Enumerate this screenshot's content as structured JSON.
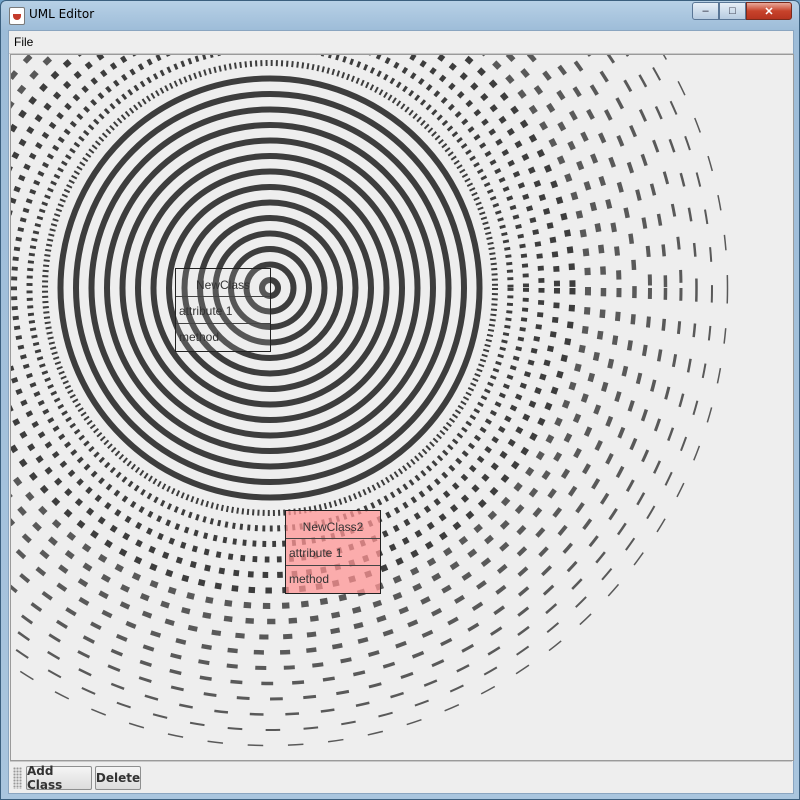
{
  "window": {
    "title": "UML Editor",
    "controls": {
      "minimize": "–",
      "maximize": "□",
      "close": "✕"
    }
  },
  "menubar": {
    "items": [
      {
        "label": "File"
      }
    ]
  },
  "canvas": {
    "classes": [
      {
        "name": "NewClass",
        "attribute": "attribute 1",
        "method": "method",
        "selected": false
      },
      {
        "name": "NewClass2",
        "attribute": "attribute 1",
        "method": "method",
        "selected": true
      }
    ],
    "colors": {
      "selected_fill": "#ff9a9a",
      "artifact_stroke": "#333333"
    }
  },
  "toolbar": {
    "buttons": [
      {
        "label": "Add Class"
      },
      {
        "label": "Delete"
      }
    ]
  }
}
